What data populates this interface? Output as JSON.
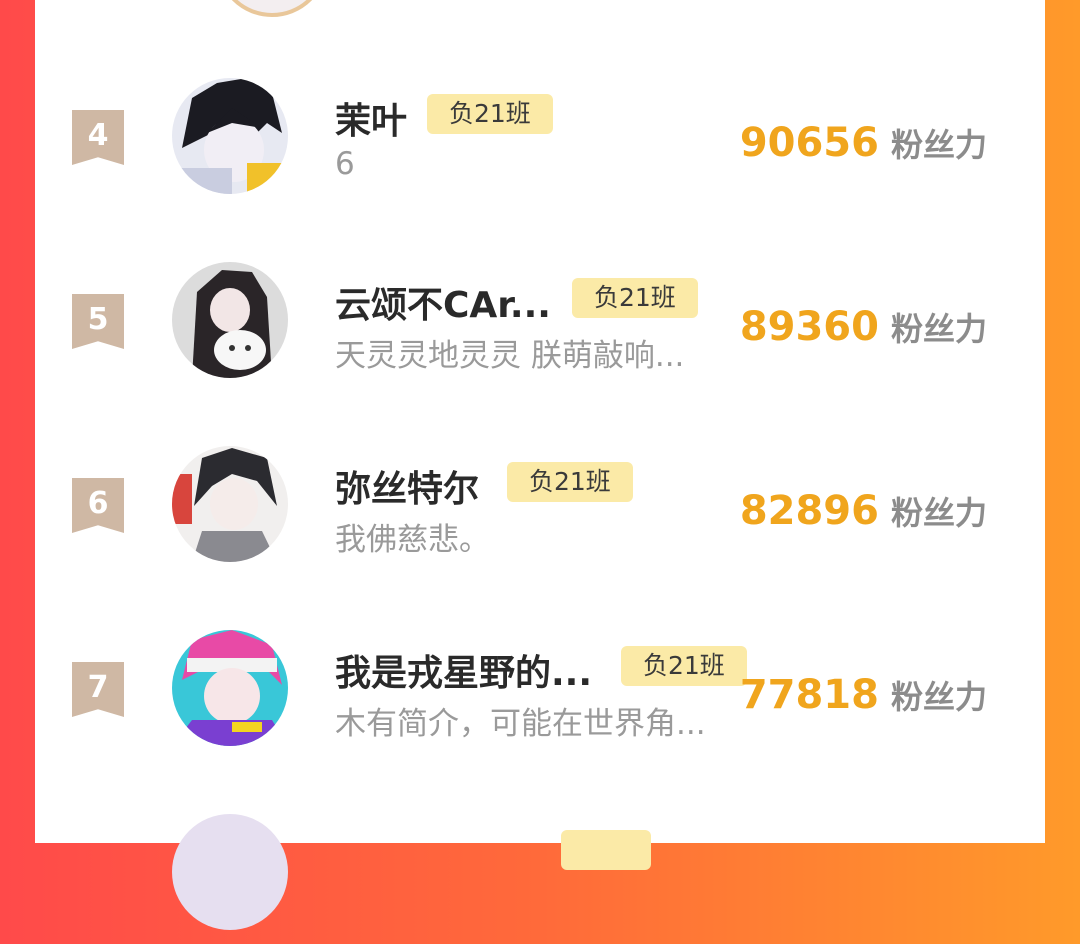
{
  "colors": {
    "background_left": "#ff4a4a",
    "background_right": "#ff9a2a",
    "rank_badge": "#cfb8a4",
    "class_badge": "#fbeaa7",
    "fans_number": "#f0a51d"
  },
  "rows": [
    {
      "rank": "4",
      "name": "茉叶",
      "badge": "负21班",
      "bio": "6",
      "fans": "90656",
      "fans_label": "粉丝力"
    },
    {
      "rank": "5",
      "name": "云颂不CAr...",
      "badge": "负21班",
      "bio": "天灵灵地灵灵 朕萌敲响...",
      "fans": "89360",
      "fans_label": "粉丝力"
    },
    {
      "rank": "6",
      "name": "弥丝特尔",
      "badge": "负21班",
      "bio": "我佛慈悲。",
      "fans": "82896",
      "fans_label": "粉丝力"
    },
    {
      "rank": "7",
      "name": "我是戎星野的...",
      "badge": "负21班",
      "bio": "木有简介，可能在世界角...",
      "fans": "77818",
      "fans_label": "粉丝力"
    }
  ]
}
